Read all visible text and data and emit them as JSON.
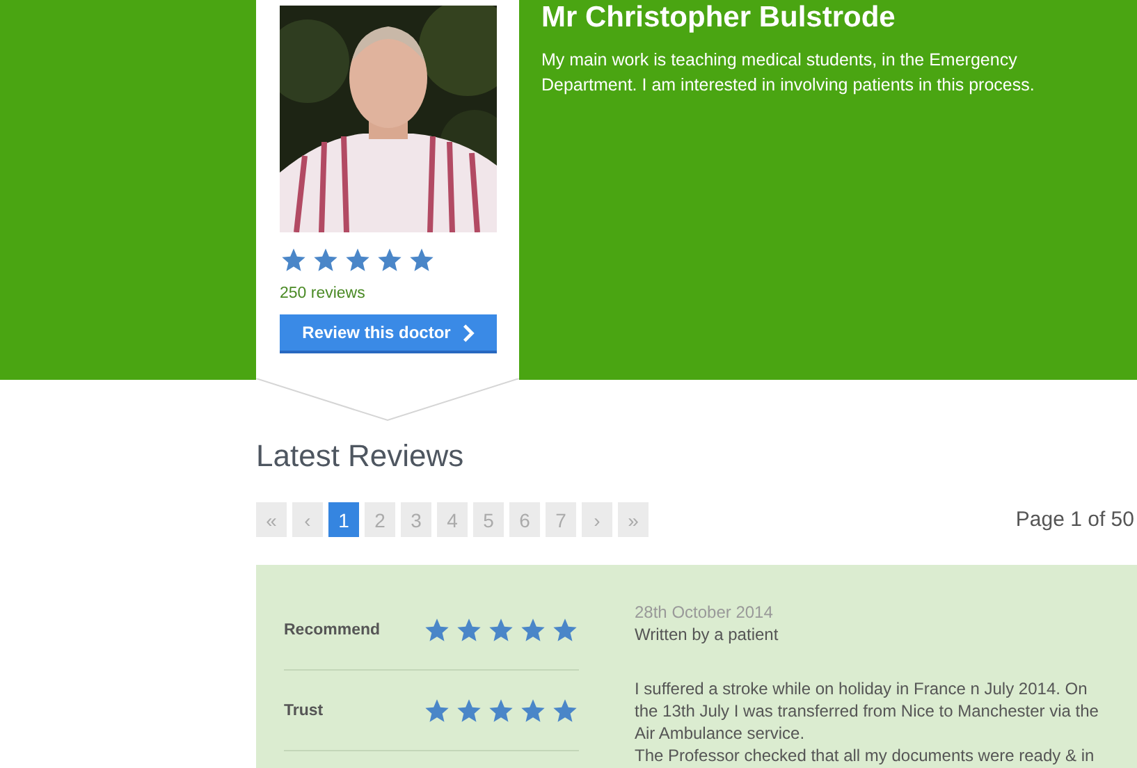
{
  "doctor": {
    "name": "Mr Christopher Bulstrode",
    "bio": "My main work is teaching medical students, in the Emergency Department. I am interested in involving patients in this process.",
    "stars": 5,
    "review_count": "250 reviews",
    "review_button": "Review this doctor"
  },
  "latest_reviews": {
    "heading": "Latest Reviews",
    "pagination": [
      {
        "label": "«",
        "selected": false
      },
      {
        "label": "‹",
        "selected": false
      },
      {
        "label": "1",
        "selected": true
      },
      {
        "label": "2",
        "selected": false
      },
      {
        "label": "3",
        "selected": false
      },
      {
        "label": "4",
        "selected": false
      },
      {
        "label": "5",
        "selected": false
      },
      {
        "label": "6",
        "selected": false
      },
      {
        "label": "7",
        "selected": false
      },
      {
        "label": "›",
        "selected": false
      },
      {
        "label": "»",
        "selected": false
      }
    ],
    "page_info": "Page 1 of 50",
    "review": {
      "ratings": [
        {
          "label": "Recommend",
          "stars": 5
        },
        {
          "label": "Trust",
          "stars": 5
        }
      ],
      "date": "28th October 2014",
      "author": "Written by a patient",
      "paragraphs": [
        "I suffered a stroke while on holiday in France n July 2014. On the 13th July I was transferred from Nice to Manchester via the Air Ambulance service.",
        "The Professor checked that all my documents were ready & in"
      ]
    }
  }
}
